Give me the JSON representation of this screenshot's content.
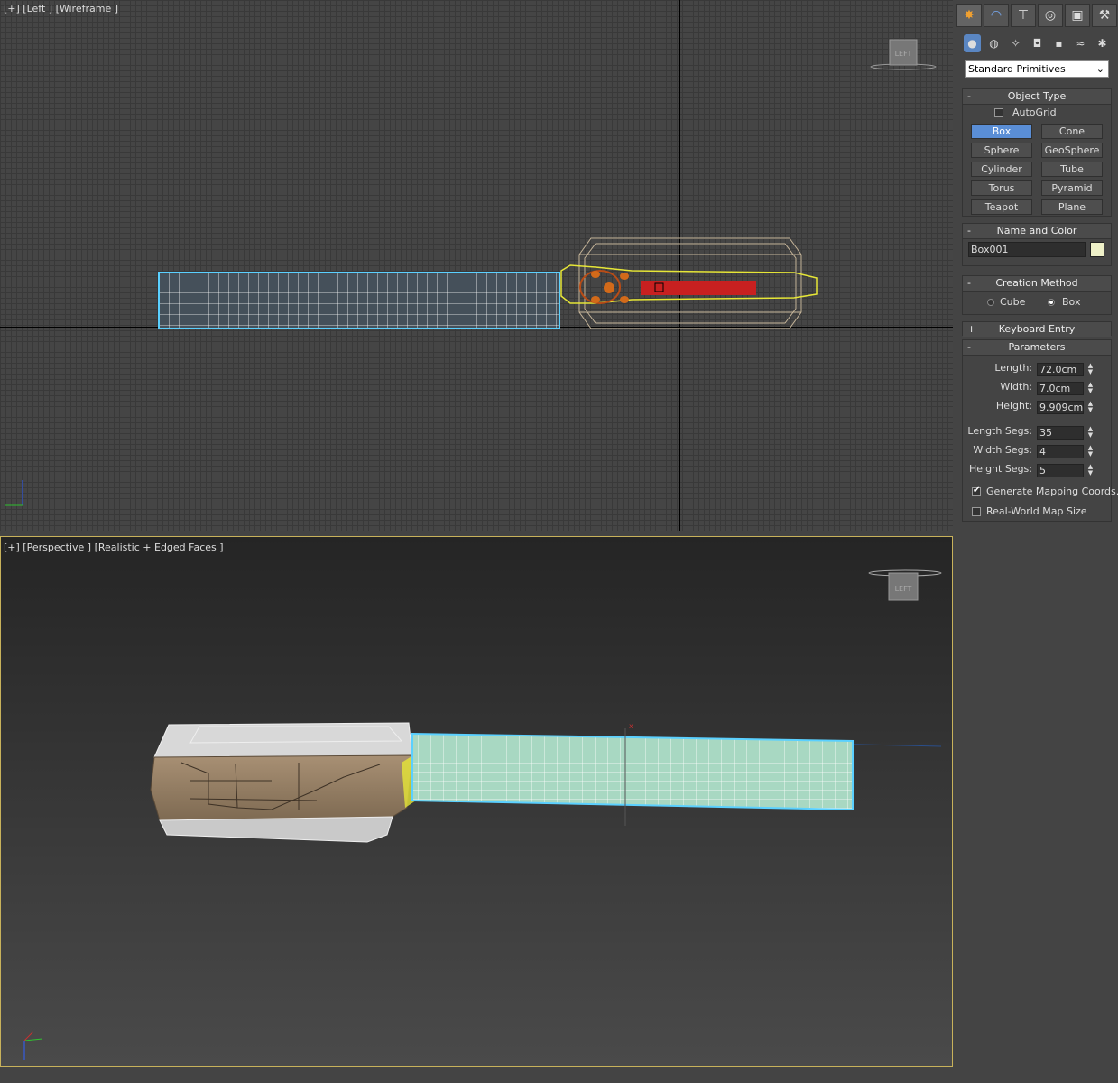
{
  "viewports": {
    "top": {
      "label": "[+] [Left ] [Wireframe ]",
      "viewcube_face": "LEFT"
    },
    "bottom": {
      "label": "[+] [Perspective ] [Realistic + Edged Faces ]",
      "viewcube_face": "LEFT"
    }
  },
  "command_panel": {
    "tabs": [
      {
        "name": "create-tab",
        "icon": "sun-icon",
        "glyph": "✸"
      },
      {
        "name": "modify-tab",
        "icon": "curve-icon",
        "glyph": "◠"
      },
      {
        "name": "hierarchy-tab",
        "icon": "hierarchy-icon",
        "glyph": "⊤"
      },
      {
        "name": "motion-tab",
        "icon": "motion-icon",
        "glyph": "◎"
      },
      {
        "name": "display-tab",
        "icon": "display-icon",
        "glyph": "▣"
      },
      {
        "name": "utilities-tab",
        "icon": "hammer-icon",
        "glyph": "⚒"
      }
    ],
    "subcategories": [
      {
        "name": "geometry-icon",
        "glyph": "●"
      },
      {
        "name": "shapes-icon",
        "glyph": "◍"
      },
      {
        "name": "lights-icon",
        "glyph": "✧"
      },
      {
        "name": "cameras-icon",
        "glyph": "◘"
      },
      {
        "name": "helpers-icon",
        "glyph": "▪"
      },
      {
        "name": "spacewarps-icon",
        "glyph": "≈"
      },
      {
        "name": "systems-icon",
        "glyph": "✱"
      }
    ],
    "dropdown_value": "Standard Primitives",
    "object_type": {
      "title": "Object Type",
      "autogrid_label": "AutoGrid",
      "autogrid_checked": false,
      "buttons": [
        "Box",
        "Cone",
        "Sphere",
        "GeoSphere",
        "Cylinder",
        "Tube",
        "Torus",
        "Pyramid",
        "Teapot",
        "Plane"
      ],
      "active": "Box"
    },
    "name_and_color": {
      "title": "Name and Color",
      "name": "Box001",
      "color": "#eef0c8"
    },
    "creation_method": {
      "title": "Creation Method",
      "options": [
        "Cube",
        "Box"
      ],
      "selected": "Box"
    },
    "keyboard_entry": {
      "title": "Keyboard Entry"
    },
    "parameters": {
      "title": "Parameters",
      "length_label": "Length:",
      "length": "72.0cm",
      "width_label": "Width:",
      "width": "7.0cm",
      "height_label": "Height:",
      "height": "9.909cm",
      "length_segs_label": "Length Segs:",
      "length_segs": "35",
      "width_segs_label": "Width Segs:",
      "width_segs": "4",
      "height_segs_label": "Height Segs:",
      "height_segs": "5",
      "gen_mapping_label": "Generate Mapping Coords.",
      "gen_mapping_checked": true,
      "real_world_label": "Real-World Map Size",
      "real_world_checked": false
    }
  },
  "colors": {
    "selection": "#5ad0ff",
    "wire_yellow": "#e6e637",
    "handle_red": "#c82020",
    "viewport_border": "#c8b25b"
  }
}
